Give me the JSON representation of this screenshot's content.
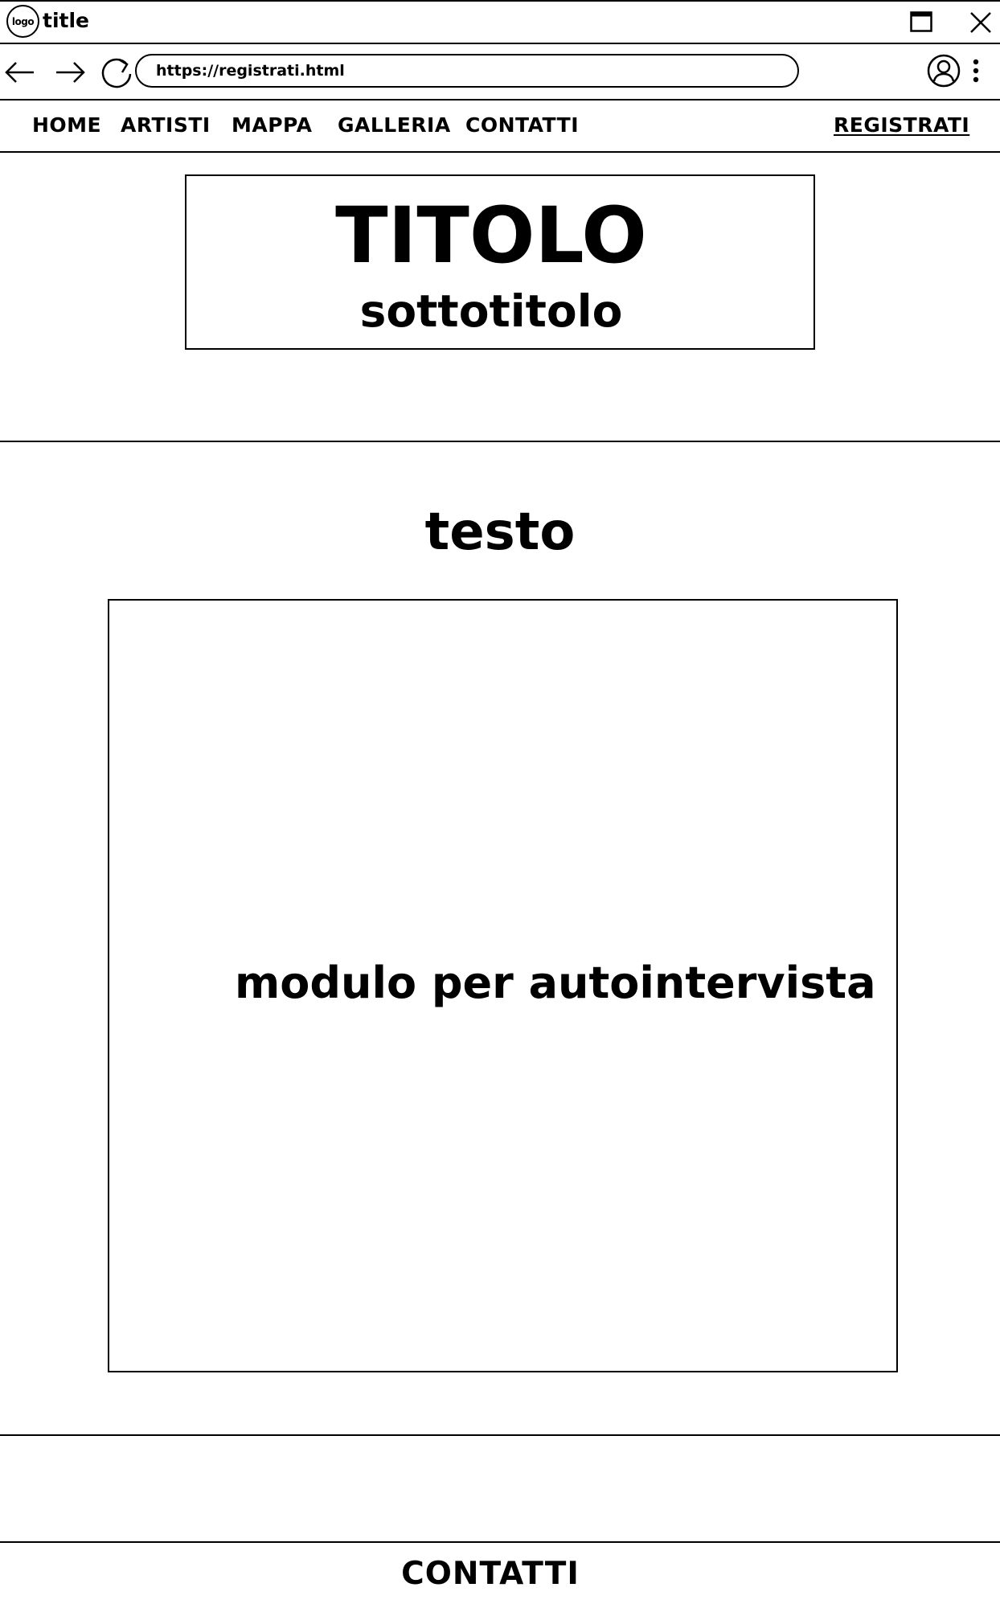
{
  "window": {
    "logo_text": "logo",
    "title": "title"
  },
  "browser": {
    "url": "https://registrati.html",
    "icons": [
      "back-arrow-icon",
      "forward-arrow-icon",
      "reload-icon",
      "profile-icon",
      "more-vertical-icon",
      "maximize-icon",
      "close-icon"
    ]
  },
  "nav": {
    "items": [
      {
        "label": "HOME"
      },
      {
        "label": "ARTISTI"
      },
      {
        "label": "MAPPA"
      },
      {
        "label": "GALLERIA"
      },
      {
        "label": "CONTATTI"
      }
    ],
    "register": "REGISTRATI"
  },
  "header": {
    "title": "TITOLO",
    "subtitle": "sottotitolo"
  },
  "main": {
    "heading": "testo",
    "form_label": "modulo per autointervista"
  },
  "footer": {
    "contacts": "CONTATTI"
  }
}
